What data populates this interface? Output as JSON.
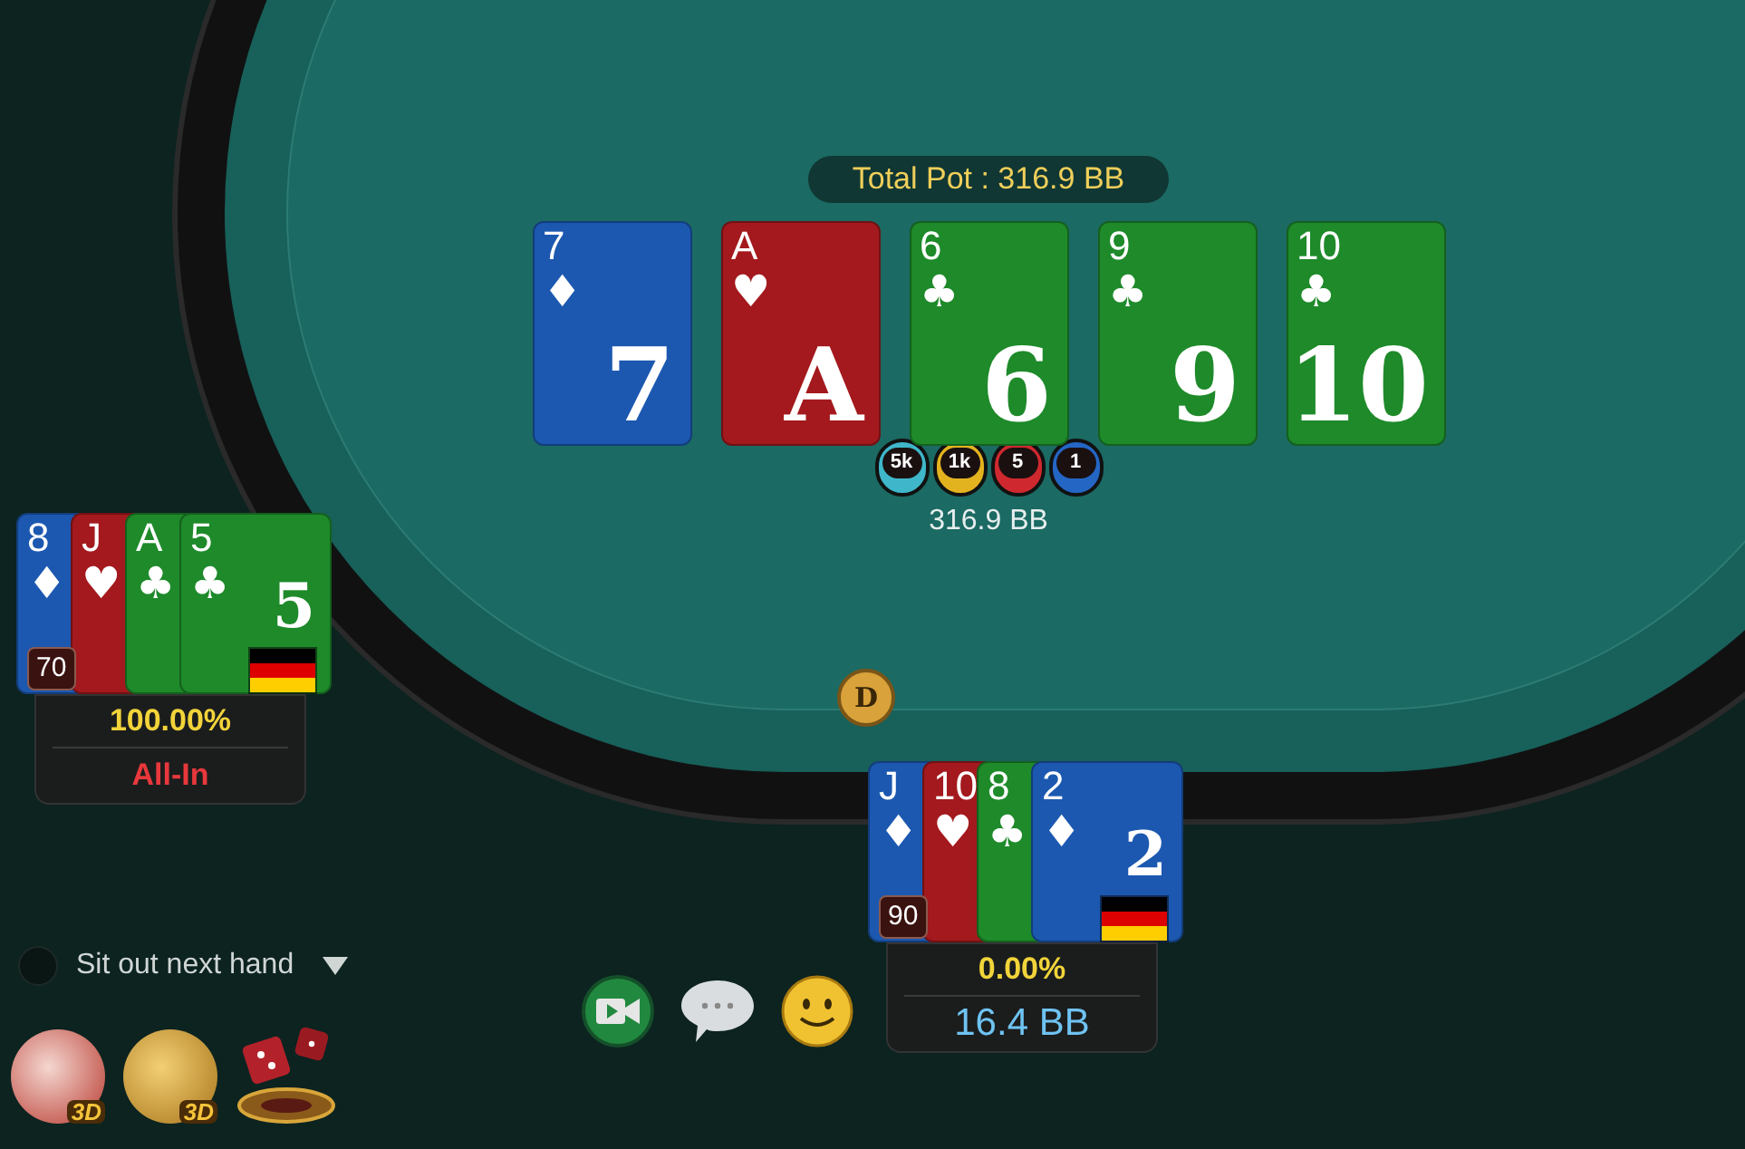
{
  "pot": {
    "label": "Total Pot : 316.9 BB"
  },
  "board": [
    {
      "rank": "7",
      "suit": "♦",
      "color": "#1c58b0",
      "rank_large": "7"
    },
    {
      "rank": "A",
      "suit": "♥",
      "color": "#a3191d",
      "rank_large": "A"
    },
    {
      "rank": "6",
      "suit": "♣",
      "color": "#1e8a2a",
      "rank_large": "6"
    },
    {
      "rank": "9",
      "suit": "♣",
      "color": "#1e8a2a",
      "rank_large": "9"
    },
    {
      "rank": "10",
      "suit": "♣",
      "color": "#1e8a2a",
      "rank_large": "10"
    }
  ],
  "chips": [
    {
      "label": "5k",
      "color": "#3fb6c9"
    },
    {
      "label": "1k",
      "color": "#e3b21f"
    },
    {
      "label": "5",
      "color": "#d0282f"
    },
    {
      "label": "1",
      "color": "#2466c4"
    }
  ],
  "pot_amount": "316.9 BB",
  "dealer_button": "D",
  "players": [
    {
      "badge": "70",
      "cards": [
        {
          "rank": "8",
          "suit": "♦",
          "color": "#1c58b0"
        },
        {
          "rank": "J",
          "suit": "♥",
          "color": "#a3191d"
        },
        {
          "rank": "A",
          "suit": "♣",
          "color": "#1e8a2a"
        },
        {
          "rank": "5",
          "suit": "♣",
          "color": "#1e8a2a",
          "rank_large": "5"
        }
      ],
      "equity": "100.00%",
      "status": {
        "kind": "all-in",
        "text": "All-In"
      }
    },
    {
      "badge": "90",
      "cards": [
        {
          "rank": "J",
          "suit": "♦",
          "color": "#1c58b0"
        },
        {
          "rank": "10",
          "suit": "♥",
          "color": "#a3191d"
        },
        {
          "rank": "8",
          "suit": "♣",
          "color": "#1e8a2a"
        },
        {
          "rank": "2",
          "suit": "♦",
          "color": "#1c58b0",
          "rank_large": "2"
        }
      ],
      "equity": "0.00%",
      "status": {
        "kind": "stack",
        "text": "16.4 BB"
      }
    }
  ],
  "sit_out": {
    "label": "Sit out next hand",
    "checked": false
  },
  "stickers": [
    {
      "label": "3D"
    },
    {
      "label": "3D"
    }
  ]
}
